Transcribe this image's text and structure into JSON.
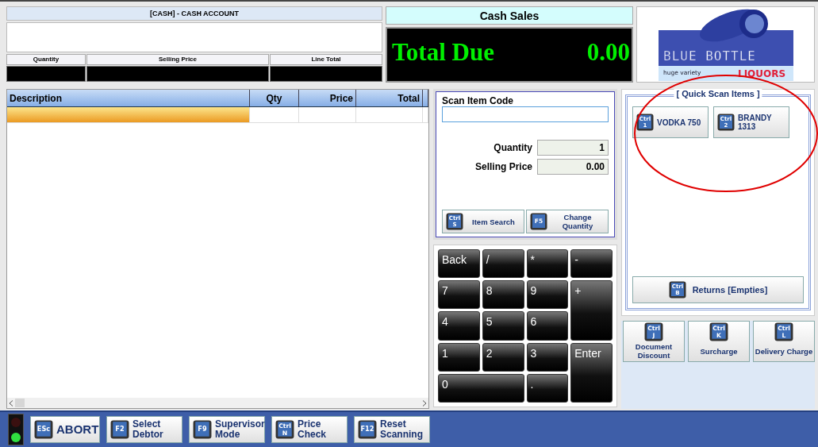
{
  "account": {
    "title": "[CASH] - CASH ACCOUNT",
    "columns": [
      "Quantity",
      "Selling Price",
      "Line Total"
    ]
  },
  "sale": {
    "title": "Cash Sales",
    "label": "Total Due",
    "amount": "0.00"
  },
  "logo": {
    "brand": "BLUE BOTTLE",
    "sub": "LIQUORS",
    "tagline": "huge variety"
  },
  "table": {
    "columns": [
      "Description",
      "Qty",
      "Price",
      "Total"
    ],
    "rows": [
      {
        "selected": true
      }
    ]
  },
  "scan": {
    "label": "Scan Item Code",
    "quantity_label": "Quantity",
    "quantity": "1",
    "price_label": "Selling Price",
    "price": "0.00",
    "buttons": [
      {
        "key": [
          "Ctrl",
          "S"
        ],
        "label": "Item Search"
      },
      {
        "key": [
          "F5"
        ],
        "label": "Change Quantity"
      }
    ]
  },
  "keypad": [
    {
      "label": "Back",
      "kind": "normal"
    },
    {
      "label": "/",
      "kind": "normal"
    },
    {
      "label": "*",
      "kind": "normal"
    },
    {
      "label": "-",
      "kind": "normal"
    },
    {
      "label": "7",
      "kind": "normal"
    },
    {
      "label": "8",
      "kind": "normal"
    },
    {
      "label": "9",
      "kind": "normal"
    },
    {
      "label": "+",
      "kind": "tall"
    },
    {
      "label": "4",
      "kind": "normal"
    },
    {
      "label": "5",
      "kind": "normal"
    },
    {
      "label": "6",
      "kind": "normal"
    },
    {
      "label": "1",
      "kind": "normal"
    },
    {
      "label": "2",
      "kind": "normal"
    },
    {
      "label": "3",
      "kind": "normal"
    },
    {
      "label": "Enter",
      "kind": "tall"
    },
    {
      "label": "0",
      "kind": "wide"
    },
    {
      "label": ".",
      "kind": "normal"
    }
  ],
  "quick": {
    "title": "[ Quick Scan Items ]",
    "items": [
      {
        "key": [
          "Ctrl",
          "1"
        ],
        "label": "VODKA 750"
      },
      {
        "key": [
          "Ctrl",
          "2"
        ],
        "label": "BRANDY 1313"
      }
    ],
    "returns": {
      "key": [
        "Ctrl",
        "B"
      ],
      "label": "Returns [Empties]"
    }
  },
  "extras": [
    {
      "key": [
        "Ctrl",
        "J"
      ],
      "label": "Document Discount"
    },
    {
      "key": [
        "Ctrl",
        "K"
      ],
      "label": "Surcharge"
    },
    {
      "key": [
        "Ctrl",
        "L"
      ],
      "label": "Delivery Charge"
    }
  ],
  "footer": {
    "green_on": true,
    "buttons": [
      {
        "key": [
          "ESc"
        ],
        "label": "ABORT",
        "kind": "big"
      },
      {
        "key": [
          "F2"
        ],
        "label": "Select Debtor",
        "kind": "small"
      },
      {
        "key": [
          "F9"
        ],
        "label": "Supervisor Mode",
        "kind": "small"
      },
      {
        "key": [
          "Ctrl",
          "N"
        ],
        "label": "Price Check",
        "kind": "small"
      },
      {
        "key": [
          "F12"
        ],
        "label": "Reset Scanning",
        "kind": "small"
      }
    ]
  }
}
